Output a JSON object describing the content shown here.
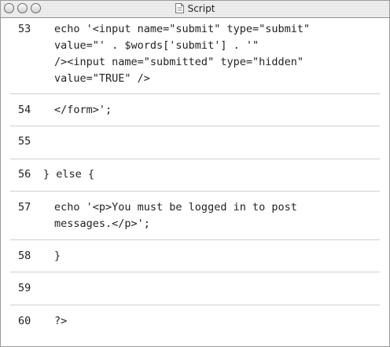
{
  "window": {
    "title": "Script"
  },
  "lines": [
    {
      "number": "53",
      "text": [
        "echo '<input name=\"submit\" type=\"submit\"",
        "value=\"' . $words['submit'] . '\"",
        "/><input name=\"submitted\" type=\"hidden\"",
        "value=\"TRUE\" />"
      ]
    },
    {
      "number": "54",
      "text": [
        "</form>';"
      ]
    },
    {
      "number": "55",
      "text": [
        ""
      ]
    },
    {
      "number": "56",
      "text": [
        "} else {"
      ]
    },
    {
      "number": "57",
      "text": [
        "echo '<p>You must be logged in to post",
        "messages.</p>';"
      ]
    },
    {
      "number": "58",
      "text": [
        "}"
      ]
    },
    {
      "number": "59",
      "text": [
        ""
      ]
    },
    {
      "number": "60",
      "text": [
        "?>"
      ]
    }
  ]
}
